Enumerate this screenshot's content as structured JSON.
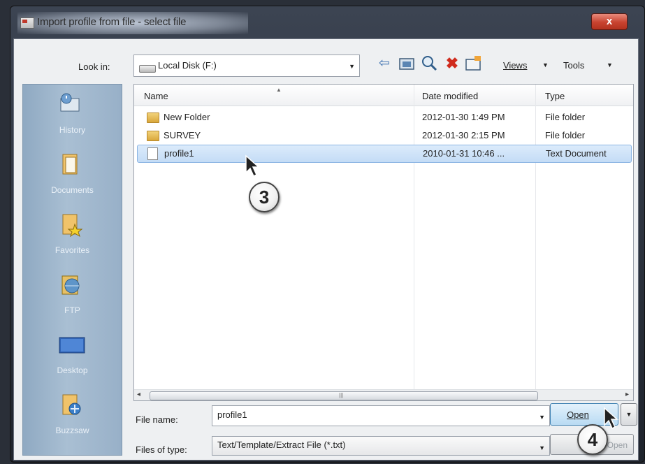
{
  "window": {
    "title": "Import profile from file - select file",
    "close_symbol": "x"
  },
  "toolbar": {
    "look_in_label": "Look in:",
    "look_in_value": "Local Disk (F:)",
    "icons": [
      "back-icon",
      "up-folder-icon",
      "search-web-icon",
      "delete-icon",
      "new-folder-icon"
    ],
    "views_label": "Views",
    "tools_label": "Tools"
  },
  "places": [
    {
      "label": "History",
      "icon": "history-icon"
    },
    {
      "label": "Documents",
      "icon": "documents-icon"
    },
    {
      "label": "Favorites",
      "icon": "favorites-icon"
    },
    {
      "label": "FTP",
      "icon": "ftp-icon"
    },
    {
      "label": "Desktop",
      "icon": "desktop-icon"
    },
    {
      "label": "Buzzsaw",
      "icon": "buzzsaw-icon"
    }
  ],
  "file_list": {
    "columns": [
      "Name",
      "Date modified",
      "Type"
    ],
    "rows": [
      {
        "name": "New Folder",
        "date": "2012-01-30 1:49 PM",
        "type": "File folder",
        "icon": "folder-icon"
      },
      {
        "name": "SURVEY",
        "date": "2012-01-30 2:15 PM",
        "type": "File folder",
        "icon": "folder-icon"
      },
      {
        "name": "profile1",
        "date": "2010-01-31 10:46 ...",
        "type": "Text Document",
        "icon": "text-document-icon",
        "selected": true
      }
    ]
  },
  "file_name": {
    "label": "File name:",
    "value": "profile1"
  },
  "file_type": {
    "label": "Files of type:",
    "value": "Text/Template/Extract File (*.txt)"
  },
  "buttons": {
    "open": "Open",
    "cancel": "Open"
  },
  "callouts": {
    "step3": "3",
    "step4": "4"
  },
  "colors": {
    "selection": "#c4dcf6",
    "places_bar": "#a9bfd3",
    "close_button": "#c8432f"
  }
}
